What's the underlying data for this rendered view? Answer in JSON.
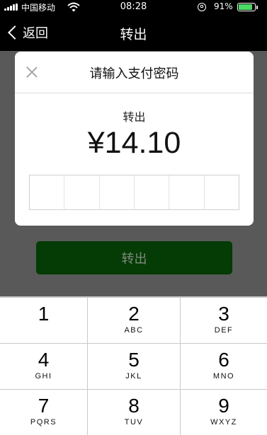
{
  "status_bar": {
    "carrier": "中国移动",
    "time": "08:28",
    "battery_percent": "91%",
    "battery_level": 0.91,
    "battery_color": "#4cd964"
  },
  "nav": {
    "back_label": "返回",
    "title": "转出"
  },
  "background_page": {
    "button_label": "转出",
    "button_color": "#053b05"
  },
  "dialog": {
    "title": "请输入支付密码",
    "subtitle": "转出",
    "amount": "¥14.10",
    "password_cells": 6
  },
  "keypad": {
    "keys": [
      {
        "num": "1",
        "letters": ""
      },
      {
        "num": "2",
        "letters": "ABC"
      },
      {
        "num": "3",
        "letters": "DEF"
      },
      {
        "num": "4",
        "letters": "GHI"
      },
      {
        "num": "5",
        "letters": "JKL"
      },
      {
        "num": "6",
        "letters": "MNO"
      },
      {
        "num": "7",
        "letters": "PQRS"
      },
      {
        "num": "8",
        "letters": "TUV"
      },
      {
        "num": "9",
        "letters": "WXYZ"
      }
    ]
  }
}
